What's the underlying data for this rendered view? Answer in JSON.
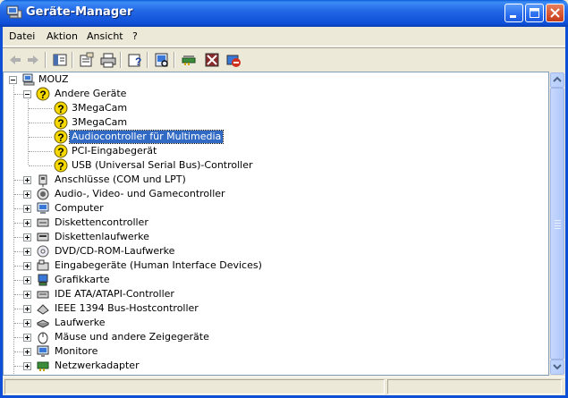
{
  "window": {
    "title": "Geräte-Manager",
    "colors": {
      "titlebar": "#0d4fd7",
      "selection": "#316ac5",
      "warning": "#f5d800"
    }
  },
  "menu": [
    "Datei",
    "Aktion",
    "Ansicht",
    "?"
  ],
  "toolbar": {
    "buttons": [
      "back-icon",
      "forward-icon",
      "show-hide-tree-icon",
      "properties-icon",
      "print-icon",
      "help-icon",
      "scan-hardware-icon",
      "update-driver-icon",
      "disable-device-icon",
      "uninstall-device-icon"
    ]
  },
  "tree": {
    "root": "MOUZ",
    "other_devices": {
      "label": "Andere Geräte",
      "children": [
        "3MegaCam",
        "3MegaCam",
        "Audiocontroller für Multimedia",
        "PCI-Eingabegerät",
        "USB (Universal Serial Bus)-Controller"
      ],
      "selected_index": 2
    },
    "categories": [
      {
        "label": "Anschlüsse (COM und LPT)",
        "icon": "port-icon"
      },
      {
        "label": "Audio-, Video- und Gamecontroller",
        "icon": "speaker-icon"
      },
      {
        "label": "Computer",
        "icon": "computer-icon"
      },
      {
        "label": "Diskettencontroller",
        "icon": "floppy-controller-icon"
      },
      {
        "label": "Diskettenlaufwerke",
        "icon": "floppy-drive-icon"
      },
      {
        "label": "DVD/CD-ROM-Laufwerke",
        "icon": "cdrom-icon"
      },
      {
        "label": "Eingabegeräte (Human Interface Devices)",
        "icon": "hid-icon"
      },
      {
        "label": "Grafikkarte",
        "icon": "display-adapter-icon"
      },
      {
        "label": "IDE ATA/ATAPI-Controller",
        "icon": "ide-controller-icon"
      },
      {
        "label": "IEEE 1394 Bus-Hostcontroller",
        "icon": "ieee1394-icon"
      },
      {
        "label": "Laufwerke",
        "icon": "disk-drive-icon"
      },
      {
        "label": "Mäuse und andere Zeigegeräte",
        "icon": "mouse-icon"
      },
      {
        "label": "Monitore",
        "icon": "monitor-icon"
      },
      {
        "label": "Netzwerkadapter",
        "icon": "network-adapter-icon"
      }
    ]
  }
}
